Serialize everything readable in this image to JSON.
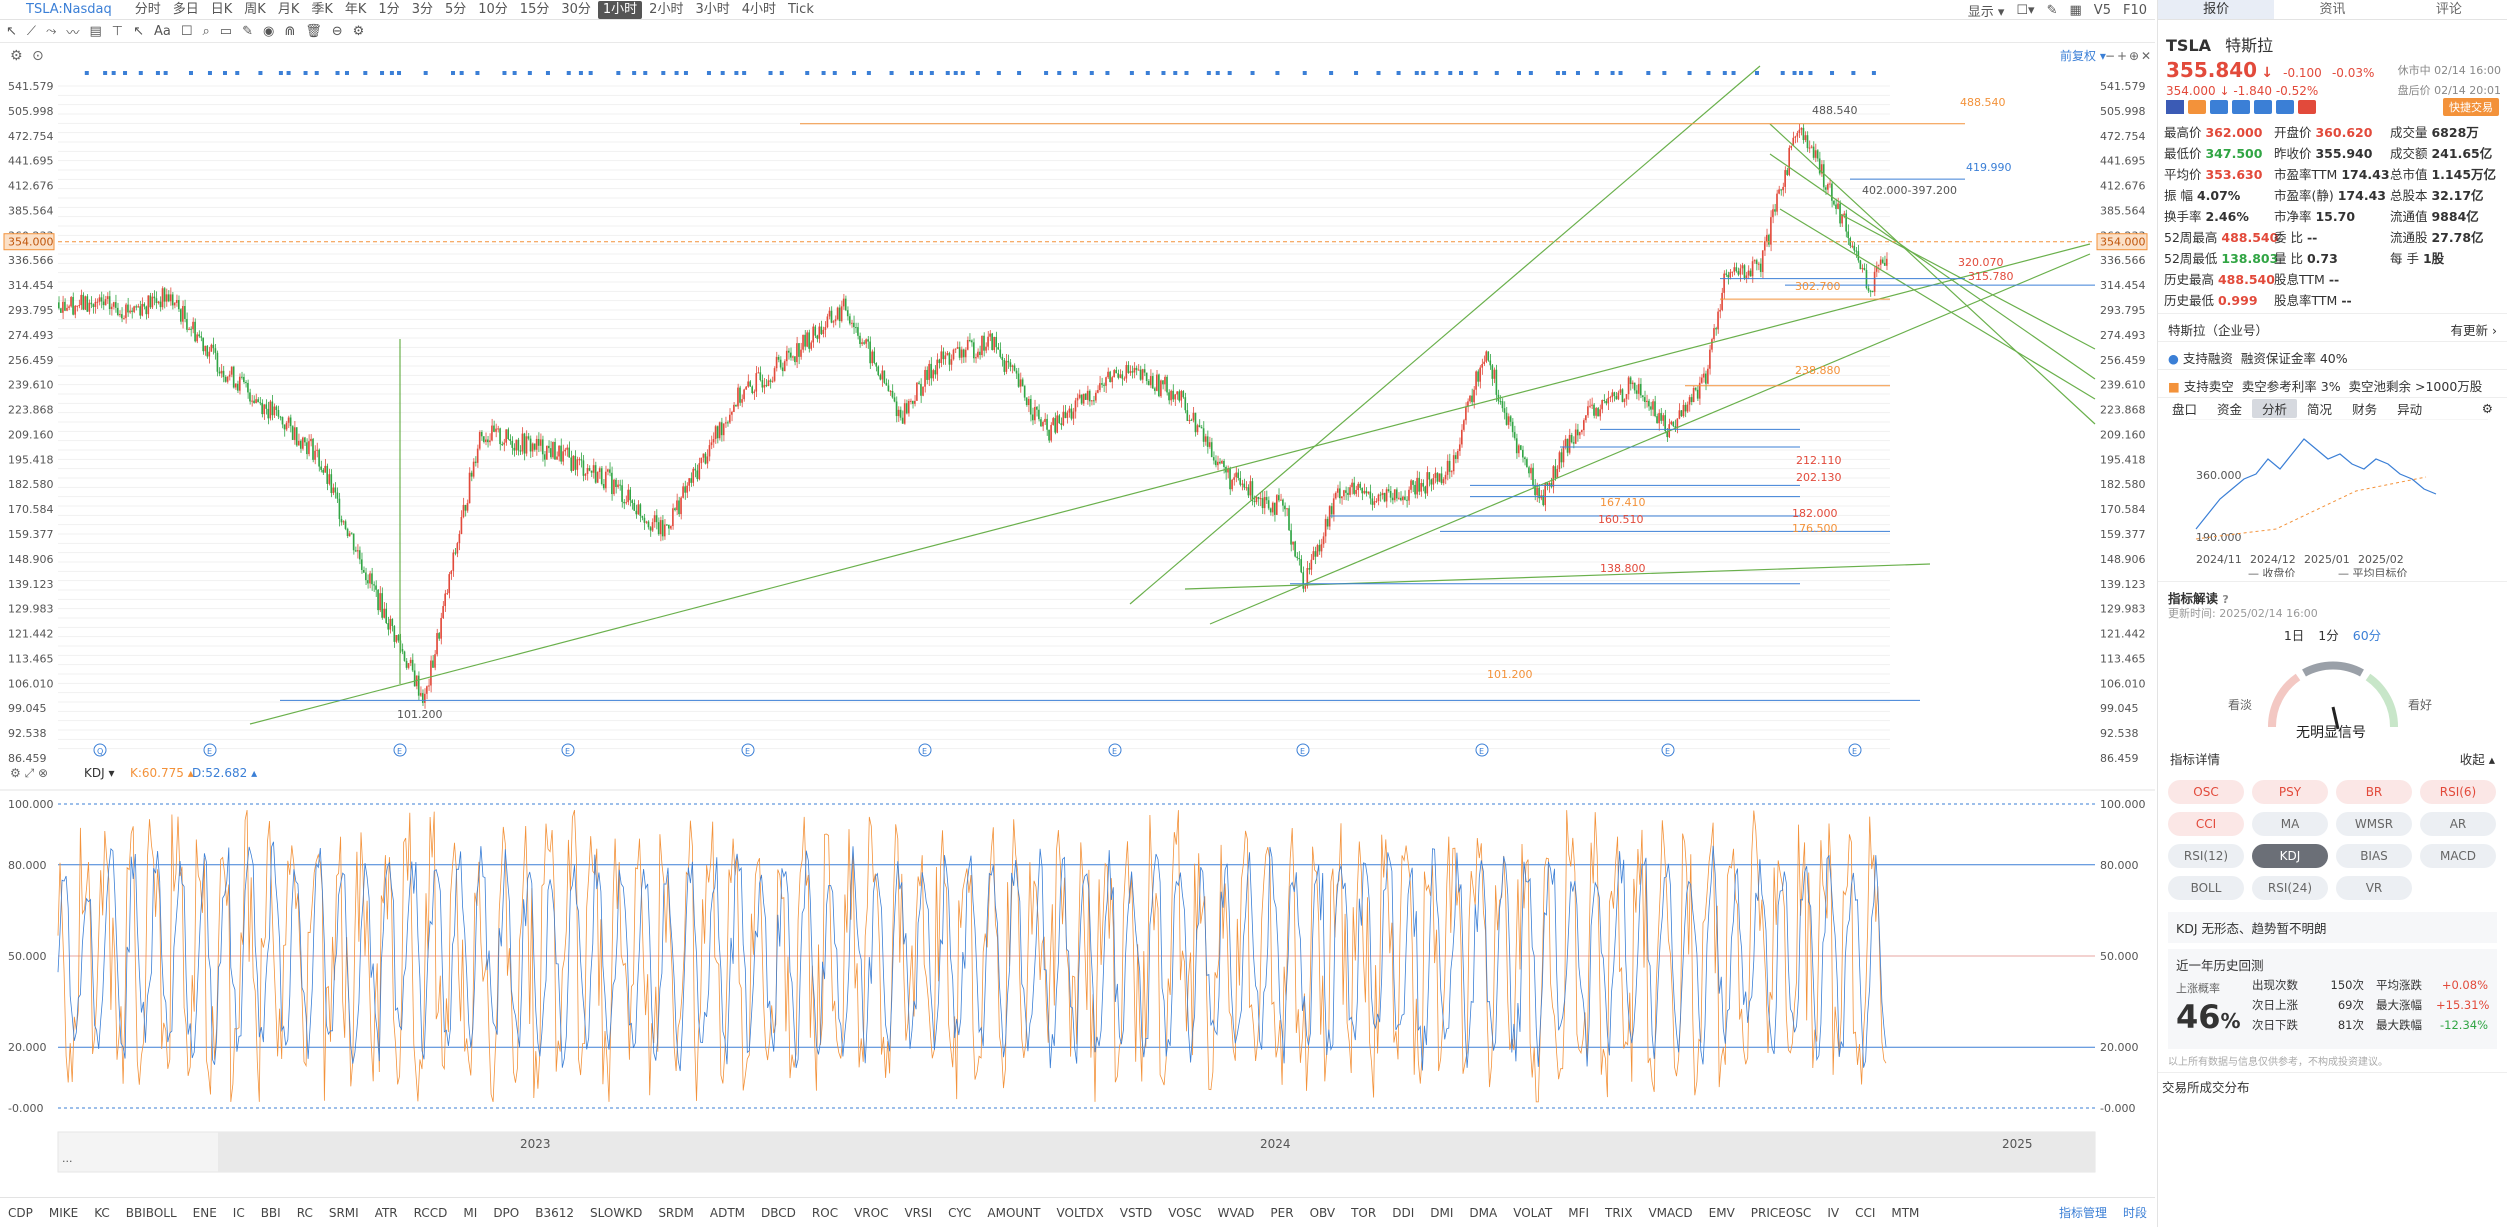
{
  "toolbar": {
    "symbol": "TSLA:Nasdaq",
    "periods": [
      "分时",
      "多日",
      "日K",
      "周K",
      "月K",
      "季K",
      "年K",
      "1分",
      "3分",
      "5分",
      "10分",
      "15分",
      "30分",
      "1小时",
      "2小时",
      "3小时",
      "4小时",
      "Tick"
    ],
    "active_period": "1小时",
    "display_label": "显示",
    "v5": "V5",
    "f10": "F10"
  },
  "chart": {
    "adjust_label": "前复权",
    "price_ticks": [
      "541.579",
      "505.998",
      "472.754",
      "441.695",
      "412.676",
      "385.564",
      "360.233",
      "336.566",
      "314.454",
      "293.795",
      "274.493",
      "256.459",
      "239.610",
      "223.868",
      "209.160",
      "195.418",
      "182.580",
      "170.584",
      "159.377",
      "148.906",
      "139.123",
      "129.983",
      "121.442",
      "113.465",
      "106.010",
      "99.045",
      "92.538",
      "86.459"
    ],
    "current_price_tag": "354.000",
    "annotations": [
      "488.540",
      "488.540",
      "419.990",
      "402.000-397.200",
      "320.070",
      "315.780",
      "302.700",
      "238.880",
      "212.110",
      "202.130",
      "182.000",
      "176.500",
      "167.410",
      "160.510",
      "138.800",
      "101.200",
      "101.200"
    ],
    "years": [
      "2023",
      "2024",
      "2025"
    ],
    "kdj": {
      "name": "KDJ",
      "k": "K:60.775",
      "d": "D:52.682",
      "ticks": [
        "100.000",
        "80.000",
        "50.000",
        "20.000",
        "-0.000"
      ]
    },
    "colors": {
      "up": "#e24a3b",
      "down": "#31a544",
      "blue": "#3b7fd6",
      "orange": "#f3923a",
      "green_line": "#6ab04c"
    }
  },
  "bottom_indicators": [
    "CDP",
    "MIKE",
    "KC",
    "BBIBOLL",
    "ENE",
    "IC",
    "BBI",
    "RC",
    "SRMI",
    "ATR",
    "RCCD",
    "MI",
    "DPO",
    "B3612",
    "SLOWKD",
    "SRDM",
    "ADTM",
    "DBCD",
    "ROC",
    "VROC",
    "VRSI",
    "CYC",
    "AMOUNT",
    "VOLTDX",
    "VSTD",
    "VOSC",
    "WVAD",
    "PER",
    "OBV",
    "TOR",
    "DDI",
    "DMI",
    "DMA",
    "VOLAT",
    "MFI",
    "TRIX",
    "VMACD",
    "EMV",
    "PRICEOSC",
    "IV",
    "CCI",
    "MTM"
  ],
  "bottom_mgr": "指标管理",
  "bottom_period": "时段",
  "side": {
    "tabs": [
      "报价",
      "资讯",
      "评论"
    ],
    "code": "TSLA",
    "name": "特斯拉",
    "price": "355.840",
    "change": "-0.100",
    "change_pct": "-0.03%",
    "status": "休市中 02/14 16:00",
    "after_price": "354.000",
    "after_change": "-1.840",
    "after_pct": "-0.52%",
    "after_status": "盘后价 02/14 20:01",
    "quick_trade": "快捷交易",
    "quote": [
      [
        "最高价",
        "362.000",
        "开盘价",
        "360.620",
        "成交量",
        "6828万"
      ],
      [
        "最低价",
        "347.500",
        "昨收价",
        "355.940",
        "成交额",
        "241.65亿"
      ],
      [
        "平均价",
        "353.630",
        "市盈率TTM",
        "174.43",
        "总市值",
        "1.145万亿"
      ],
      [
        "振    幅",
        "4.07%",
        "市盈率(静)",
        "174.43",
        "总股本",
        "32.17亿"
      ],
      [
        "换手率",
        "2.46%",
        "市净率",
        "15.70",
        "流通值",
        "9884亿"
      ],
      [
        "52周最高",
        "488.540",
        "委    比",
        "--",
        "流通股",
        "27.78亿"
      ],
      [
        "52周最低",
        "138.803",
        "量    比",
        "0.73",
        "每    手",
        "1股"
      ],
      [
        "历史最高",
        "488.540",
        "股息TTM",
        "--",
        "",
        ""
      ],
      [
        "历史最低",
        "0.999",
        "股息率TTM",
        "--",
        "",
        ""
      ]
    ],
    "company": "特斯拉（企业号）",
    "company_update": "有更新",
    "margin": "支持融资",
    "margin_rate": "融资保证金率 40%",
    "short": "支持卖空",
    "short_rate": "卖空参考利率 3%",
    "short_pool": "卖空池剩余 >1000万股",
    "subtabs": [
      "盘口",
      "资金",
      "分析",
      "简况",
      "财务",
      "异动"
    ],
    "mini_chart": {
      "y_labels": [
        "360.000",
        "190.000"
      ],
      "x_labels": [
        "2024/11",
        "2024/12",
        "2025/01",
        "2025/02"
      ],
      "legend": [
        "收盘价",
        "平均目标价"
      ]
    },
    "indicator_title": "指标解读",
    "update_time": "更新时间: 2025/02/14 16:00",
    "ranges": [
      "1日",
      "1分",
      "60分"
    ],
    "gauge_left": "看淡",
    "gauge_right": "看好",
    "gauge_result": "无明显信号",
    "detail_title": "指标详情",
    "collapse": "收起",
    "chips": [
      {
        "t": "OSC",
        "red": true
      },
      {
        "t": "PSY",
        "red": true
      },
      {
        "t": "BR",
        "red": true
      },
      {
        "t": "RSI(6)",
        "red": true
      },
      {
        "t": "CCI",
        "red": true
      },
      {
        "t": "MA"
      },
      {
        "t": "WMSR"
      },
      {
        "t": "AR"
      },
      {
        "t": "RSI(12)"
      },
      {
        "t": "KDJ",
        "active": true
      },
      {
        "t": "BIAS"
      },
      {
        "t": "MACD"
      },
      {
        "t": "BOLL"
      },
      {
        "t": "RSI(24)"
      },
      {
        "t": "VR"
      }
    ],
    "kdj_text": "KDJ 无形态、趋势暂不明朗",
    "history_title": "近一年历史回测",
    "rise_prob_label": "上涨概率",
    "rise_prob": "46",
    "stats": [
      [
        "出现次数",
        "150次",
        "平均涨跌",
        "+0.08%"
      ],
      [
        "次日上涨",
        "69次",
        "最大涨幅",
        "+15.31%"
      ],
      [
        "次日下跌",
        "81次",
        "最大跌幅",
        "-12.34%"
      ]
    ],
    "disclaimer": "以上所有数据与信息仅供参考，不构成投资建议。",
    "footer": "交易所成交分布"
  }
}
